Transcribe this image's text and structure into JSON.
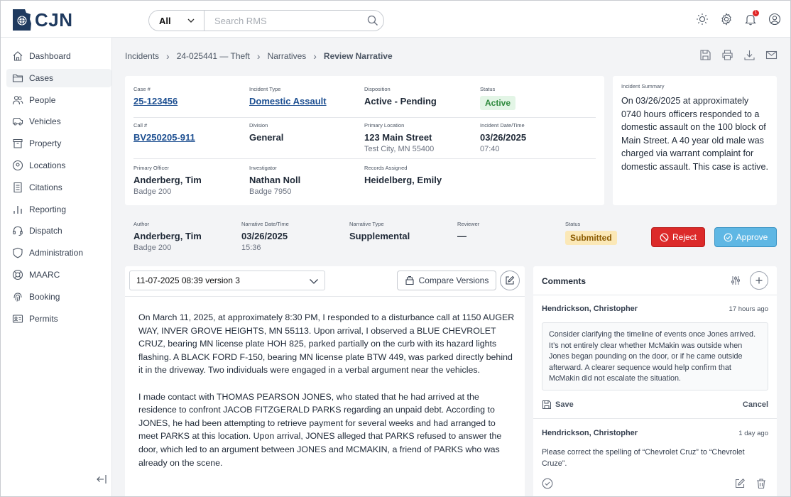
{
  "app": {
    "logo_text": "CJN"
  },
  "search": {
    "scope": "All",
    "placeholder": "Search RMS"
  },
  "topbar": {
    "notification_count": "1"
  },
  "sidebar": {
    "items": [
      {
        "label": "Dashboard",
        "icon": "home-icon"
      },
      {
        "label": "Cases",
        "icon": "folder-icon",
        "active": true
      },
      {
        "label": "People",
        "icon": "people-icon"
      },
      {
        "label": "Vehicles",
        "icon": "car-icon"
      },
      {
        "label": "Property",
        "icon": "archive-icon"
      },
      {
        "label": "Locations",
        "icon": "location-pin-icon"
      },
      {
        "label": "Citations",
        "icon": "receipt-icon"
      },
      {
        "label": "Reporting",
        "icon": "bar-chart-icon"
      },
      {
        "label": "Dispatch",
        "icon": "headset-icon"
      },
      {
        "label": "Administration",
        "icon": "shield-icon"
      },
      {
        "label": "MAARC",
        "icon": "lifebuoy-icon"
      },
      {
        "label": "Booking",
        "icon": "fingerprint-icon"
      },
      {
        "label": "Permits",
        "icon": "id-card-icon"
      }
    ]
  },
  "breadcrumb": {
    "items": [
      "Incidents",
      "24-025441 — Theft",
      "Narratives"
    ],
    "current": "Review Narrative"
  },
  "case": {
    "case_no": {
      "label": "Case #",
      "value": "25-123456"
    },
    "incident_type": {
      "label": "Incident Type",
      "value": "Domestic Assault"
    },
    "disposition": {
      "label": "Disposition",
      "value": "Active - Pending"
    },
    "status": {
      "label": "Status",
      "value": "Active"
    },
    "call_no": {
      "label": "Call #",
      "value": "BV250205-911"
    },
    "division": {
      "label": "Division",
      "value": "General"
    },
    "primary_location": {
      "label": "Primary Location",
      "value": "123 Main Street",
      "sub": "Test City, MN 55400"
    },
    "incident_datetime": {
      "label": "Incident Date/Time",
      "value": "03/26/2025",
      "sub": "07:40"
    },
    "primary_officer": {
      "label": "Primary Officer",
      "value": "Anderberg, Tim",
      "sub": "Badge 200"
    },
    "investigator": {
      "label": "Investigator",
      "value": "Nathan Noll",
      "sub": "Badge 7950"
    },
    "records_assigned": {
      "label": "Records Assigned",
      "value": "Heidelberg, Emily"
    }
  },
  "summary": {
    "label": "Incident Summary",
    "text": "On 03/26/2025 at approximately 0740 hours officers responded to a domestic assault on the 100 block of Main Street. A 40 year old male was charged via warrant complaint for domestic assault. This case is active."
  },
  "narrative": {
    "author": {
      "label": "Author",
      "value": "Anderberg, Tim",
      "sub": "Badge 200"
    },
    "datetime": {
      "label": "Narrative Date/Time",
      "value": "03/26/2025",
      "sub": "15:36"
    },
    "type": {
      "label": "Narrative Type",
      "value": "Supplemental"
    },
    "reviewer": {
      "label": "Reviewer",
      "value": "—"
    },
    "status": {
      "label": "Status",
      "value": "Submitted"
    },
    "reject_label": "Reject",
    "approve_label": "Approve",
    "version": "11-07-2025 08:39 version 3",
    "compare_label": "Compare Versions",
    "paragraphs": [
      "On March 11, 2025, at approximately 8:30 PM, I responded to a disturbance call at 1150 AUGER WAY, INVER GROVE HEIGHTS, MN 55113. Upon arrival, I observed a BLUE CHEVROLET CRUZ, bearing MN license plate HOH 825, parked partially on the curb with its hazard lights flashing. A BLACK FORD F-150, bearing MN license plate BTW 449, was parked directly behind it in the driveway. Two individuals were engaged in a verbal argument near the vehicles.",
      "I made contact with THOMAS PEARSON JONES, who stated that he had arrived at the residence to confront JACOB FITZGERALD PARKS regarding an unpaid debt. According to JONES, he had been attempting to retrieve payment for several weeks and had arranged to meet PARKS at this location. Upon arrival, JONES alleged that PARKS refused to answer the door, which led to an argument between JONES and MCMAKIN, a friend of PARKS who was already on the scene."
    ]
  },
  "comments": {
    "title": "Comments",
    "items": [
      {
        "author": "Hendrickson, Christopher",
        "time": "17 hours ago",
        "text": "Consider clarifying the timeline of events once Jones arrived. It’s not entirely clear whether McMakin was outside when Jones began pounding on the door, or if he came outside afterward. A clearer sequence would help confirm that McMakin did not escalate the situation.",
        "save_label": "Save",
        "cancel_label": "Cancel"
      },
      {
        "author": "Hendrickson, Christopher",
        "time": "1 day ago",
        "text": "Please correct the spelling of “Chevrolet Cruz” to “Chevrolet Cruze”."
      }
    ]
  },
  "colors": {
    "brand": "#1f3a5f",
    "reject": "#dc2a2a",
    "approve": "#5fb7e4",
    "active_badge": "#e3f5e6",
    "submitted_badge": "#fbe8b7",
    "link": "#1d4f91"
  }
}
